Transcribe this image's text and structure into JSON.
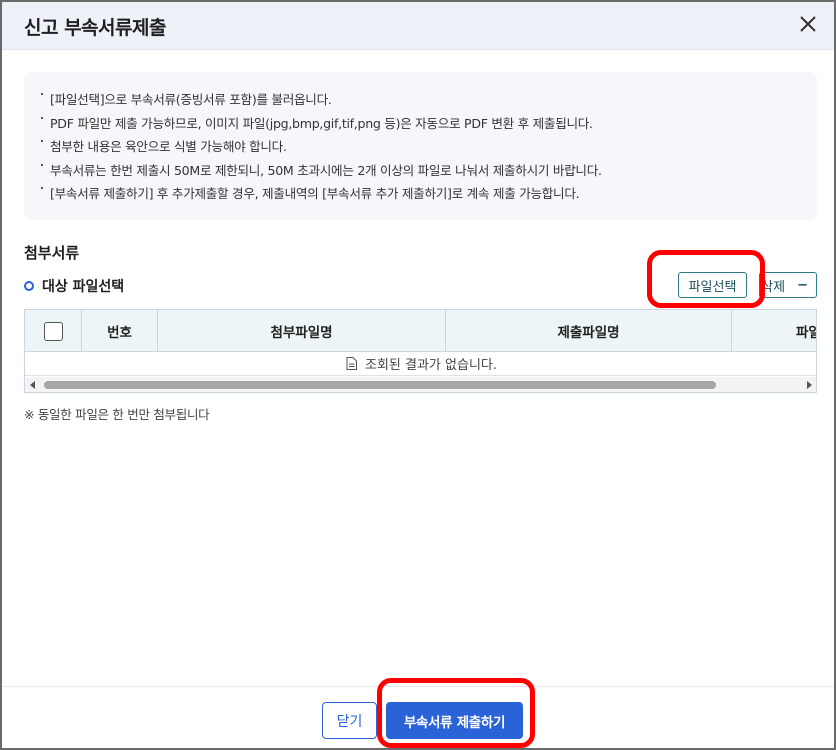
{
  "dialog": {
    "title": "신고 부속서류제출",
    "close_icon": "close-icon"
  },
  "notice": {
    "items": [
      "[파일선택]으로 부속서류(증빙서류 포함)를 불러옵니다.",
      "PDF 파일만 제출 가능하므로, 이미지 파일(jpg,bmp,gif,tif,png 등)은 자동으로 PDF 변환 후 제출됩니다.",
      "첨부한 내용은 육안으로 식별 가능해야 합니다.",
      "부속서류는 한번 제출시 50M로 제한되니, 50M 초과시에는 2개 이상의 파일로 나눠서 제출하시기 바랍니다.",
      "[부속서류 제출하기] 후 추가제출할 경우, 제출내역의 [부속서류 추가 제출하기]로 계속 제출 가능합니다."
    ]
  },
  "attachments": {
    "section_title": "첨부서류",
    "sub_title": "대상 파일선택",
    "file_select_label": "파일선택",
    "delete_label": "삭제",
    "delete_icon": "minus",
    "table": {
      "columns": [
        "번호",
        "첨부파일명",
        "제출파일명",
        "파일"
      ],
      "empty_message": "조회된 결과가 없습니다."
    },
    "footnote": "※ 동일한 파일은 한 번만 첨부됩니다"
  },
  "footer": {
    "close_label": "닫기",
    "submit_label": "부속서류 제출하기"
  },
  "colors": {
    "primary": "#2a63d8",
    "highlight": "#ff0000",
    "header_bg": "#eef2f8",
    "notice_bg": "#f5f7fb"
  }
}
